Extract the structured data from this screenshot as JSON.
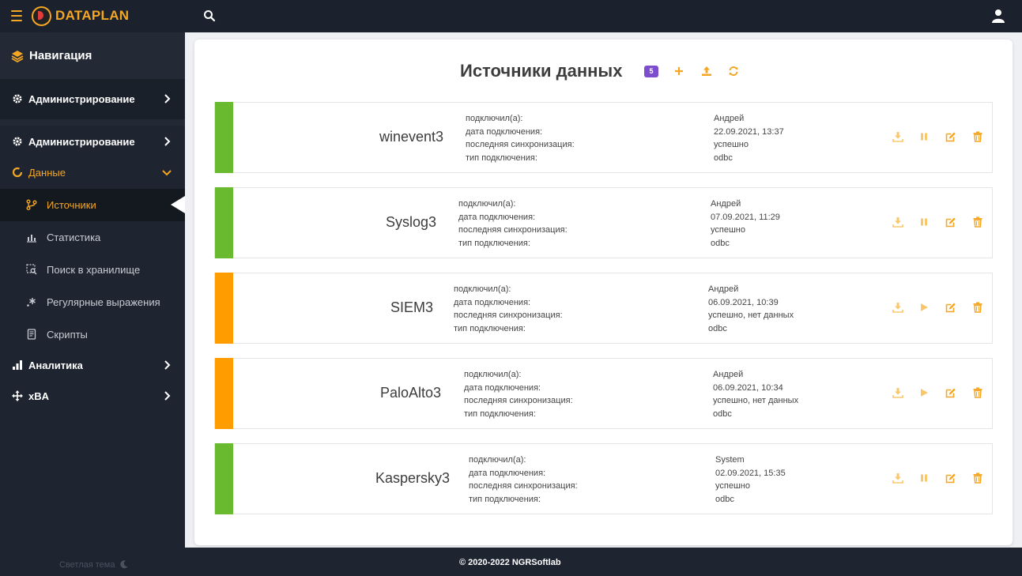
{
  "app": {
    "brand": "DATAPLAN"
  },
  "sidebar": {
    "header": "Навигация",
    "admin_top": "Администрирование",
    "items": [
      {
        "label": "Администрирование"
      },
      {
        "label": "Данные"
      },
      {
        "label": "Аналитика"
      },
      {
        "label": "xBA"
      }
    ],
    "sub_items": [
      {
        "label": "Источники"
      },
      {
        "label": "Статистика"
      },
      {
        "label": "Поиск в хранилище"
      },
      {
        "label": "Регулярные выражения"
      },
      {
        "label": "Скрипты"
      }
    ],
    "theme_toggle": "Светлая тема"
  },
  "page": {
    "title": "Источники данных",
    "count": "5"
  },
  "field_labels": {
    "connected_by": "подключил(а):",
    "connected_at": "дата подключения:",
    "last_sync": "последняя синхронизация:",
    "conn_type": "тип подключения:"
  },
  "sources": [
    {
      "name": "winevent3",
      "user": "Андрей",
      "date": "22.09.2021, 13:37",
      "sync": "успешно",
      "type": "odbc",
      "status_color": "#6aba2f",
      "action": "pause"
    },
    {
      "name": "Syslog3",
      "user": "Андрей",
      "date": "07.09.2021, 11:29",
      "sync": "успешно",
      "type": "odbc",
      "status_color": "#6aba2f",
      "action": "pause"
    },
    {
      "name": "SIEM3",
      "user": "Андрей",
      "date": "06.09.2021, 10:39",
      "sync": "успешно, нет данных",
      "type": "odbc",
      "status_color": "#ff9c00",
      "action": "play"
    },
    {
      "name": "PaloAlto3",
      "user": "Андрей",
      "date": "06.09.2021, 10:34",
      "sync": "успешно, нет данных",
      "type": "odbc",
      "status_color": "#ff9c00",
      "action": "play"
    },
    {
      "name": "Kaspersky3",
      "user": "System",
      "date": "02.09.2021, 15:35",
      "sync": "успешно",
      "type": "odbc",
      "status_color": "#6aba2f",
      "action": "pause"
    }
  ],
  "footer": {
    "copyright": "© 2020-2022 NGRSoftlab"
  },
  "colors": {
    "accent": "#f5a623",
    "accent_light": "#f8c76a",
    "badge": "#7c4dcc"
  }
}
